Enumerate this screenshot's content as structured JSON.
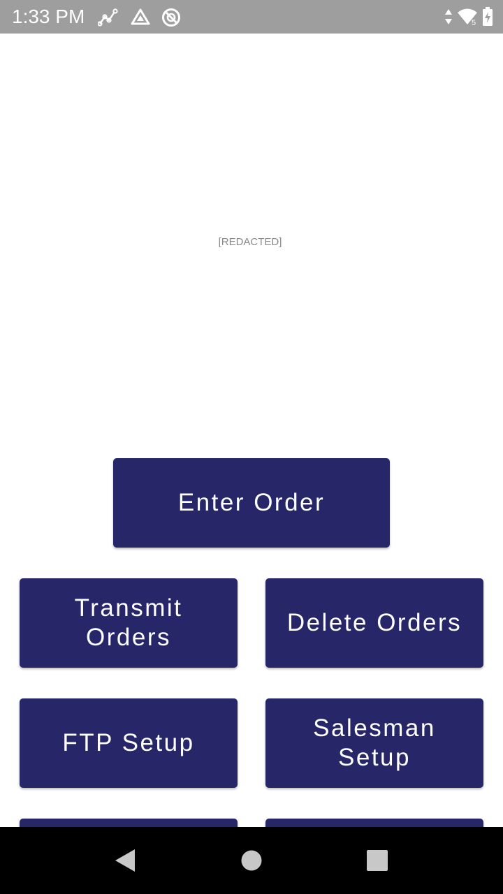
{
  "status_bar": {
    "time": "1:33 PM",
    "background": "#9e9e9e",
    "left_icons": [
      "analytics-icon",
      "drive-icon",
      "sync-disabled-icon"
    ],
    "right_icons": [
      "data-arrows-icon",
      "wifi-icon",
      "battery-charging-icon"
    ],
    "wifi_badge": "5"
  },
  "main": {
    "logo_text": "[REDACTED]",
    "accent_color": "#262668",
    "buttons": {
      "enter_order": "Enter Order",
      "transmit_orders": "Transmit Orders",
      "delete_orders": "Delete Orders",
      "ftp_setup": "FTP Setup",
      "salesman_setup": "Salesman Setup"
    }
  },
  "nav_bar": {
    "icons": [
      "back-icon",
      "home-icon",
      "recents-icon"
    ]
  }
}
